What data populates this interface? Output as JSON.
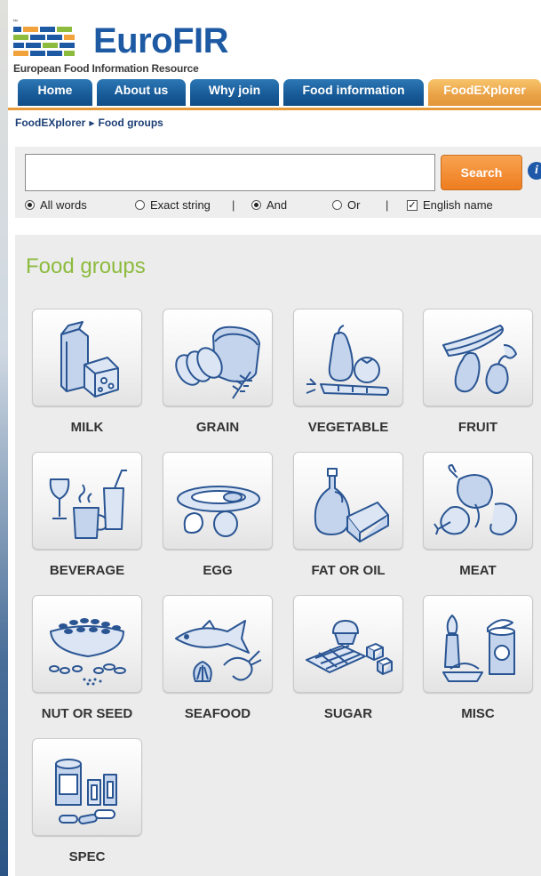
{
  "header": {
    "brand": "EuroFIR",
    "tagline": "European Food Information Resource",
    "trademark": "™"
  },
  "nav": {
    "tabs": [
      {
        "label": "Home"
      },
      {
        "label": "About us"
      },
      {
        "label": "Why join"
      },
      {
        "label": "Food information"
      },
      {
        "label": "FoodEXplorer",
        "active": true
      }
    ]
  },
  "breadcrumb": {
    "items": [
      "FoodEXplorer",
      "Food groups"
    ]
  },
  "search": {
    "value": "",
    "button_label": "Search",
    "info_icon": "i",
    "options": {
      "all_words": {
        "label": "All words",
        "checked": true
      },
      "exact_string": {
        "label": "Exact string",
        "checked": false
      },
      "and": {
        "label": "And",
        "checked": true
      },
      "or": {
        "label": "Or",
        "checked": false
      },
      "english_name": {
        "label": "English name",
        "checked": true
      },
      "separator": "|"
    }
  },
  "food_groups": {
    "title": "Food groups",
    "items": [
      {
        "label": "MILK",
        "icon": "milk-icon"
      },
      {
        "label": "GRAIN",
        "icon": "bread-icon"
      },
      {
        "label": "VEGETABLE",
        "icon": "vegetable-icon"
      },
      {
        "label": "FRUIT",
        "icon": "fruit-icon"
      },
      {
        "label": "BEVERAGE",
        "icon": "beverage-icon"
      },
      {
        "label": "EGG",
        "icon": "egg-icon"
      },
      {
        "label": "FAT OR OIL",
        "icon": "oil-icon"
      },
      {
        "label": "MEAT",
        "icon": "meat-icon"
      },
      {
        "label": "NUT OR SEED",
        "icon": "nut-icon"
      },
      {
        "label": "SEAFOOD",
        "icon": "fish-icon"
      },
      {
        "label": "SUGAR",
        "icon": "sugar-icon"
      },
      {
        "label": "MISC",
        "icon": "misc-icon"
      },
      {
        "label": "SPEC",
        "icon": "supplement-icon"
      }
    ]
  },
  "colors": {
    "nav_blue": "#175a97",
    "nav_active": "#e69a3a",
    "brand_blue": "#1d5aa3",
    "title_green": "#8dbb3e",
    "search_orange": "#ee7d1f",
    "icon_stroke": "#2a5593",
    "icon_fill": "#c4d4ec"
  }
}
